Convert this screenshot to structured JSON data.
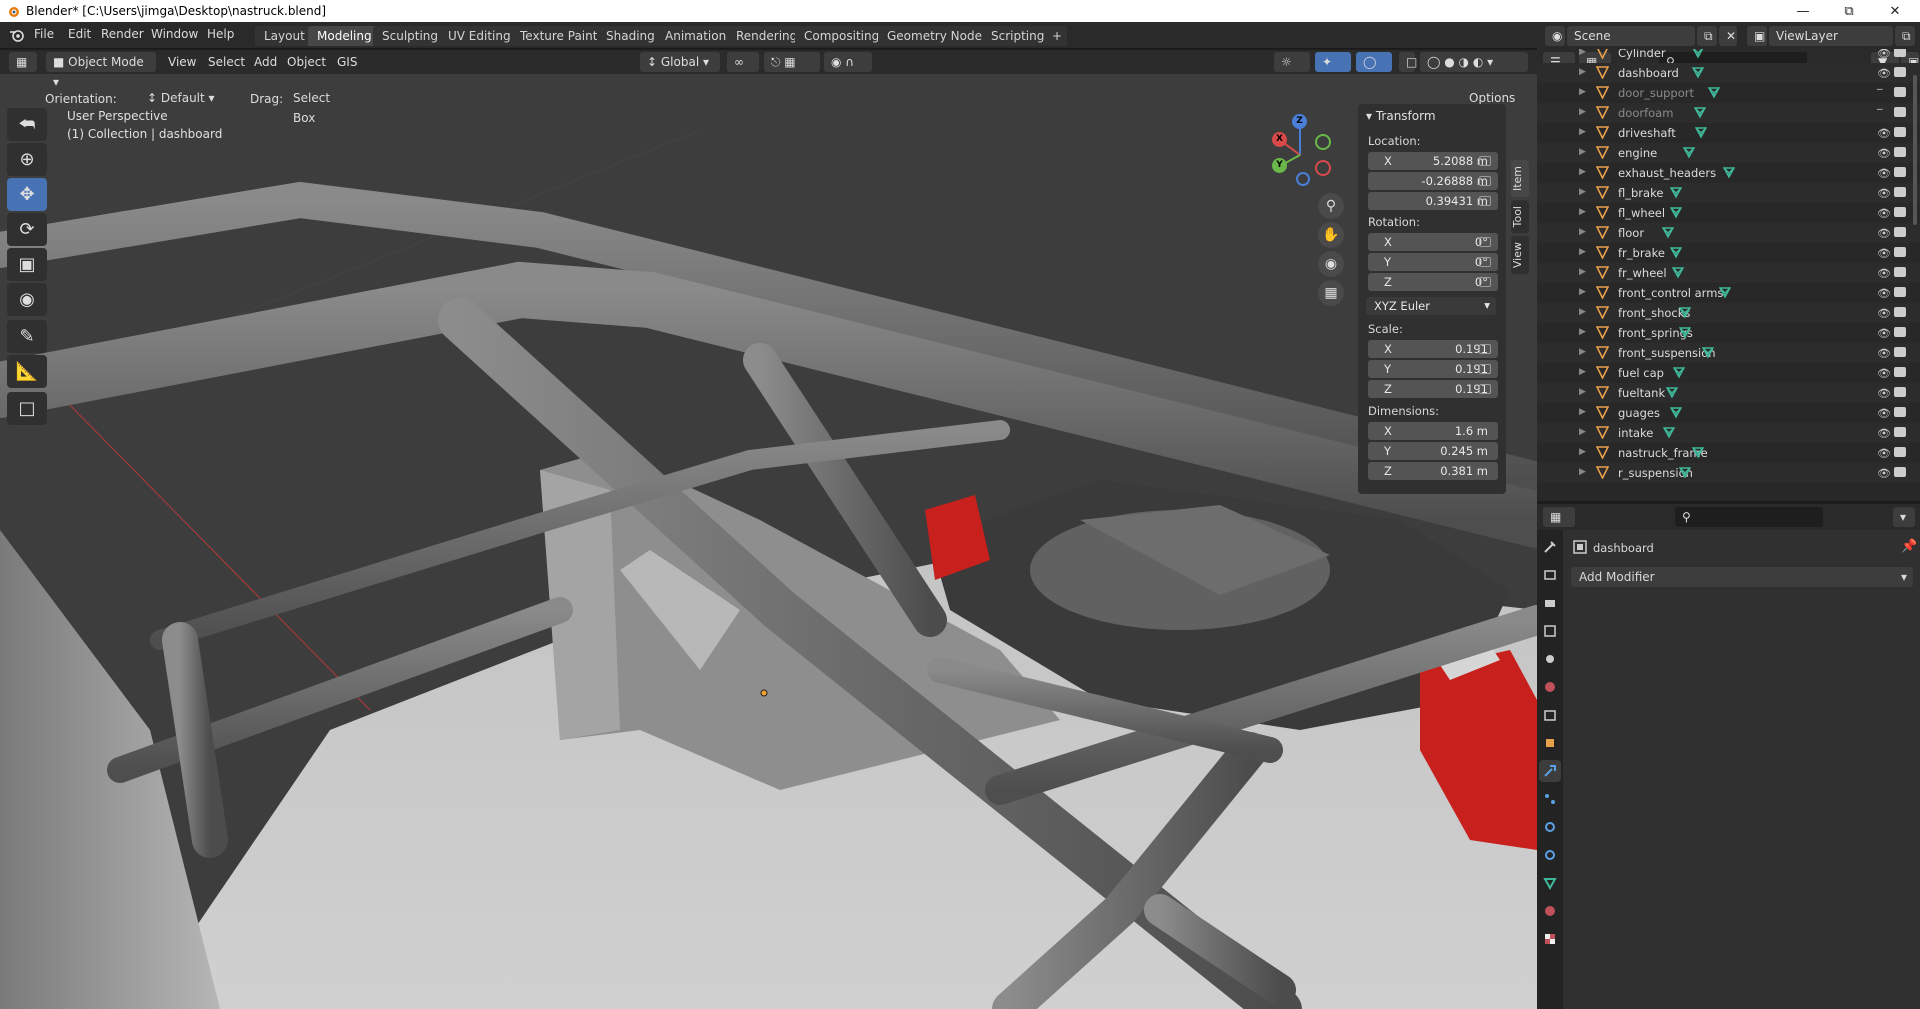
{
  "window": {
    "title": "Blender* [C:\\Users\\jimga\\Desktop\\nastruck.blend]",
    "min_icon": "minimize-icon",
    "max_icon": "maximize-icon",
    "close_icon": "close-icon"
  },
  "menus": [
    "File",
    "Edit",
    "Render",
    "Window",
    "Help"
  ],
  "workspaces": [
    "Layout",
    "Modeling",
    "Sculpting",
    "UV Editing",
    "Texture Paint",
    "Shading",
    "Animation",
    "Rendering",
    "Compositing",
    "Geometry Nodes",
    "Scripting"
  ],
  "active_workspace": "Modeling",
  "scene": {
    "name": "Scene",
    "view_layer": "ViewLayer"
  },
  "viewport": {
    "mode": "Object Mode",
    "menus": [
      "View",
      "Select",
      "Add",
      "Object",
      "GIS"
    ],
    "transform_orientation": "Global",
    "orientation_label": "Orientation:",
    "orientation_value": "Default",
    "drag_label": "Drag:",
    "drag_value": "Select Box",
    "options_label": "Options",
    "perspective": "User Perspective",
    "collection_info": "(1) Collection | dashboard",
    "gizmo": {
      "x": "X",
      "y": "Y",
      "z": "Z"
    }
  },
  "npanel": {
    "tabs": [
      "Item",
      "Tool",
      "View"
    ],
    "transform_title": "Transform",
    "location_label": "Location:",
    "location": [
      {
        "axis": "X",
        "value": "5.2088 m"
      },
      {
        "axis": "",
        "value": "-0.26888 m"
      },
      {
        "axis": "",
        "value": "0.39431 m"
      }
    ],
    "rotation_label": "Rotation:",
    "rotation": [
      {
        "axis": "X",
        "value": "0°"
      },
      {
        "axis": "Y",
        "value": "0°"
      },
      {
        "axis": "Z",
        "value": "0°"
      }
    ],
    "rotation_mode": "XYZ Euler",
    "scale_label": "Scale:",
    "scale": [
      {
        "axis": "X",
        "value": "0.191"
      },
      {
        "axis": "Y",
        "value": "0.191"
      },
      {
        "axis": "Z",
        "value": "0.191"
      }
    ],
    "dimensions_label": "Dimensions:",
    "dimensions": [
      {
        "axis": "X",
        "value": "1.6 m"
      },
      {
        "axis": "Y",
        "value": "0.245 m"
      },
      {
        "axis": "Z",
        "value": "0.381 m"
      }
    ]
  },
  "outliner": {
    "items": [
      {
        "name": "Cylinder",
        "dim": false
      },
      {
        "name": "dashboard",
        "dim": false
      },
      {
        "name": "door_support",
        "dim": true
      },
      {
        "name": "doorfoam",
        "dim": true
      },
      {
        "name": "driveshaft",
        "dim": false
      },
      {
        "name": "engine",
        "dim": false
      },
      {
        "name": "exhaust_headers",
        "dim": false
      },
      {
        "name": "fl_brake",
        "dim": false
      },
      {
        "name": "fl_wheel",
        "dim": false
      },
      {
        "name": "floor",
        "dim": false
      },
      {
        "name": "fr_brake",
        "dim": false
      },
      {
        "name": "fr_wheel",
        "dim": false
      },
      {
        "name": "front_control arms",
        "dim": false
      },
      {
        "name": "front_shocks",
        "dim": false
      },
      {
        "name": "front_springs",
        "dim": false
      },
      {
        "name": "front_suspension",
        "dim": false
      },
      {
        "name": "fuel cap",
        "dim": false
      },
      {
        "name": "fueltank",
        "dim": false
      },
      {
        "name": "guages",
        "dim": false
      },
      {
        "name": "intake",
        "dim": false
      },
      {
        "name": "nastruck_frame",
        "dim": false
      },
      {
        "name": "r_suspension",
        "dim": false
      }
    ]
  },
  "properties": {
    "object_name": "dashboard",
    "add_modifier": "Add Modifier"
  },
  "colors": {
    "accent": "#4772b3",
    "mesh_icon": "#3fb89a",
    "object_icon": "#e8a04a",
    "spring_red": "#c8201c"
  }
}
